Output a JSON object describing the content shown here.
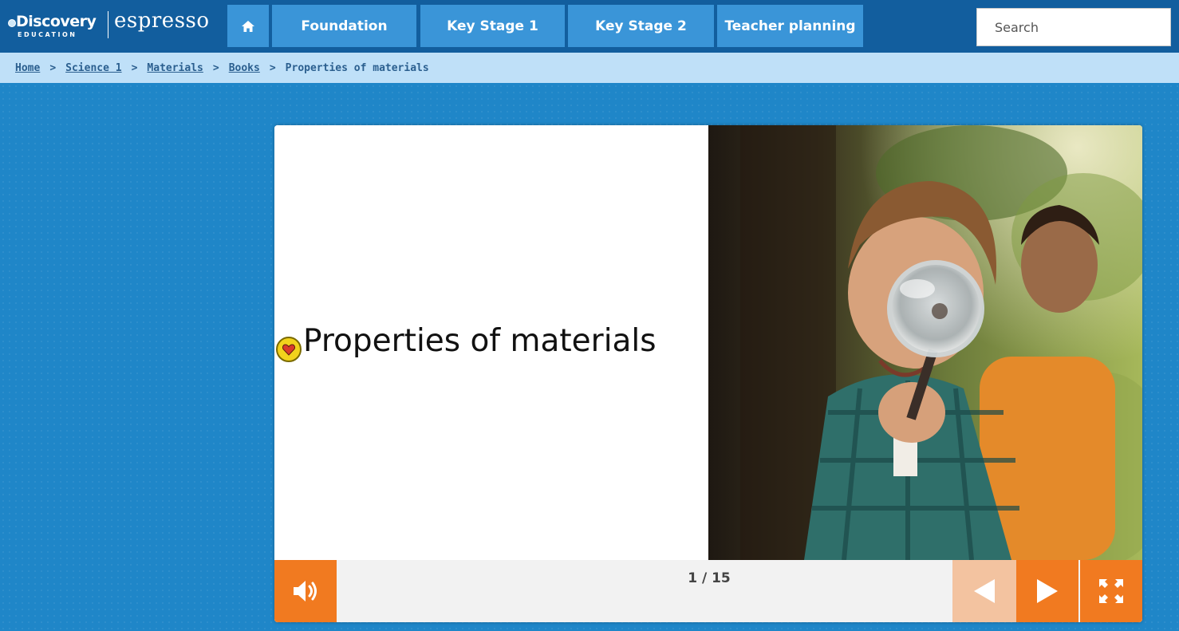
{
  "header": {
    "logo_brand": "Discovery",
    "logo_sub": "EDUCATION",
    "logo_product": "espresso",
    "home_icon": "home-icon",
    "nav": [
      {
        "label": "Foundation"
      },
      {
        "label": "Key Stage 1"
      },
      {
        "label": "Key Stage 2"
      },
      {
        "label": "Teacher planning"
      }
    ],
    "search_placeholder": "Search"
  },
  "breadcrumb": {
    "items": [
      "Home",
      "Science 1",
      "Materials",
      "Books"
    ],
    "separator": ">",
    "current": "Properties of materials"
  },
  "book": {
    "title": "Properties of materials",
    "glossary_icon": "glossary-heart-icon",
    "image_icon": "photo-boy-magnifying-glass",
    "page_counter": "1 / 15",
    "audio_icon": "speaker-icon",
    "prev_icon": "triangle-left-icon",
    "next_icon": "triangle-right-icon",
    "fullscreen_icon": "fullscreen-icon"
  },
  "colors": {
    "background": "#1f86c8",
    "topbar": "#125e9e",
    "nav_button": "#3a95d8",
    "breadcrumb_bar": "#bfe0f8",
    "accent_orange": "#f17a20",
    "disabled_orange": "#f3c3a0"
  }
}
